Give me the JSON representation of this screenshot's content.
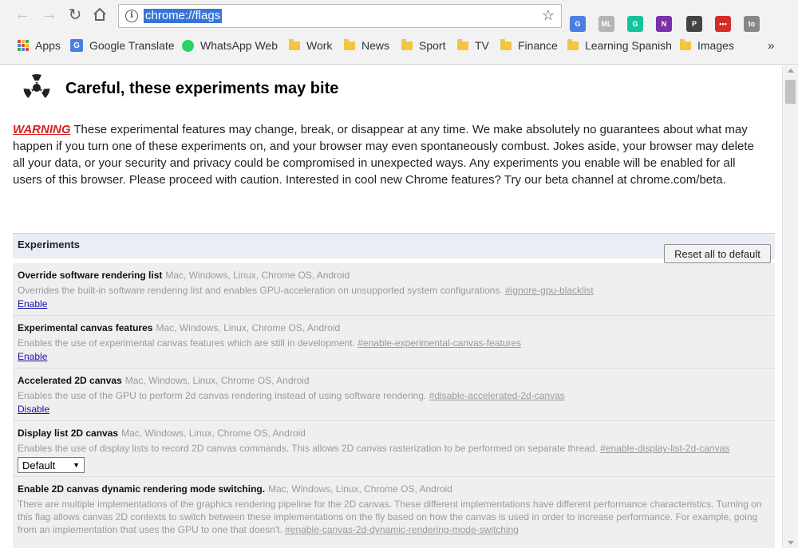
{
  "toolbar": {
    "url": "chrome://flags",
    "extensions": [
      {
        "name": "translate-ext",
        "label": "G",
        "color": "#4a7fe0"
      },
      {
        "name": "ml-ext",
        "label": "ML",
        "color": "#b5b5b5"
      },
      {
        "name": "grammarly-ext",
        "label": "G",
        "color": "#15c39a"
      },
      {
        "name": "onenote-ext",
        "label": "N",
        "color": "#7b2fa8"
      },
      {
        "name": "pocket-ext",
        "label": "P",
        "color": "#444444"
      },
      {
        "name": "lastpass-ext",
        "label": "•••",
        "color": "#d32d27"
      },
      {
        "name": "ublock-ext",
        "label": "to",
        "color": "#888888"
      }
    ]
  },
  "bookmarks": {
    "apps": "Apps",
    "google_translate": "Google Translate",
    "whatsapp": "WhatsApp Web",
    "folders": [
      "Work",
      "News",
      "Sport",
      "TV",
      "Finance",
      "Learning Spanish",
      "Images"
    ],
    "more": "»"
  },
  "page": {
    "title": "Careful, these experiments may bite",
    "warning_label": "WARNING",
    "warning_text": " These experimental features may change, break, or disappear at any time. We make absolutely no guarantees about what may happen if you turn one of these experiments on, and your browser may even spontaneously combust. Jokes aside, your browser may delete all your data, or your security and privacy could be compromised in unexpected ways. Any experiments you enable will be enabled for all users of this browser. Please proceed with caution. Interested in cool new Chrome features? Try our beta channel at chrome.com/beta.",
    "experiments_header": "Experiments",
    "reset_label": "Reset all to default"
  },
  "experiments": [
    {
      "name": "Override software rendering list",
      "platforms": "Mac, Windows, Linux, Chrome OS, Android",
      "description": "Overrides the built-in software rendering list and enables GPU-acceleration on unsupported system configurations.",
      "flag": "#ignore-gpu-blacklist",
      "action": "Enable"
    },
    {
      "name": "Experimental canvas features",
      "platforms": "Mac, Windows, Linux, Chrome OS, Android",
      "description": "Enables the use of experimental canvas features which are still in development.",
      "flag": "#enable-experimental-canvas-features",
      "action": "Enable"
    },
    {
      "name": "Accelerated 2D canvas",
      "platforms": "Mac, Windows, Linux, Chrome OS, Android",
      "description": "Enables the use of the GPU to perform 2d canvas rendering instead of using software rendering.",
      "flag": "#disable-accelerated-2d-canvas",
      "action": "Disable"
    },
    {
      "name": "Display list 2D canvas",
      "platforms": "Mac, Windows, Linux, Chrome OS, Android",
      "description": "Enables the use of display lists to record 2D canvas commands. This allows 2D canvas rasterization to be performed on separate thread.",
      "flag": "#enable-display-list-2d-canvas",
      "select": "Default"
    },
    {
      "name": "Enable 2D canvas dynamic rendering mode switching.",
      "platforms": "Mac, Windows, Linux, Chrome OS, Android",
      "description": "There are multiple implementations of the graphics rendering pipeline for the 2D canvas. These different implementations have different performance characteristics. Turning on this flag allows canvas 2D contexts to switch between these implementations on the fly based on how the canvas is used in order to increase performance. For example, going from an implementation that uses the GPU to one that doesn't.",
      "flag": "#enable-canvas-2d-dynamic-rendering-mode-switching"
    }
  ]
}
